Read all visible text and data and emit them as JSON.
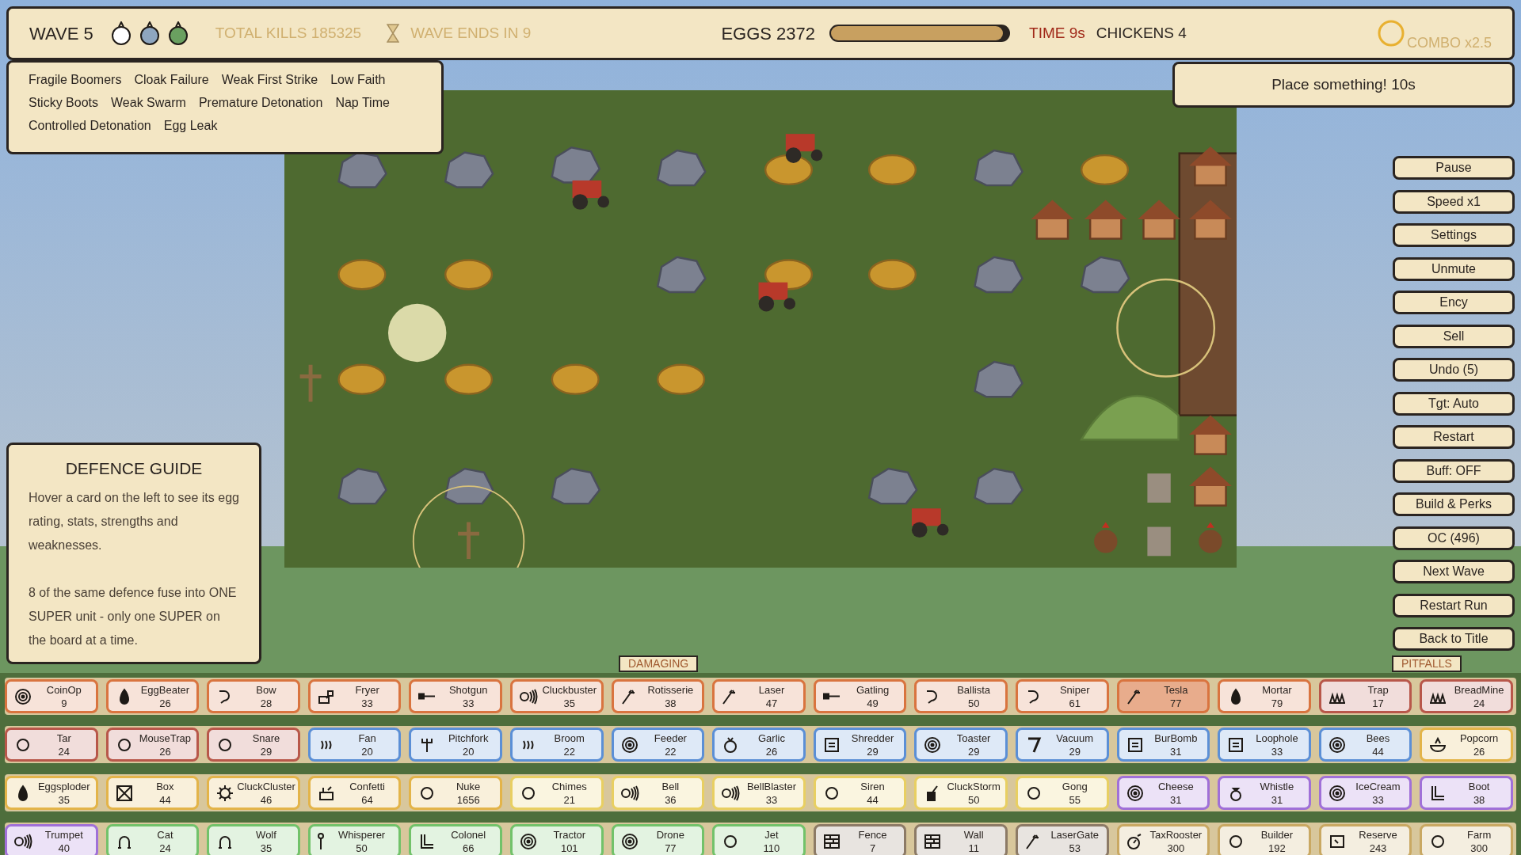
{
  "hud": {
    "wave": "WAVE 5",
    "enemy_types": [
      {
        "color": "#ffffff"
      },
      {
        "color": "#8ea6c0"
      },
      {
        "color": "#6aa060"
      }
    ],
    "total_kills": "TOTAL KILLS 185325",
    "wave_timer": "WAVE ENDS IN 9",
    "eggs": "EGGS 2372",
    "egg_bar": {
      "level": 0.97
    },
    "time": "TIME 9s",
    "chickens": "CHICKENS 4",
    "combo": "COMBO x2.5"
  },
  "modifiers": [
    "Fragile Boomers",
    "Cloak Failure",
    "Weak First Strike",
    "Low Faith",
    "Sticky Boots",
    "Weak Swarm",
    "Premature Detonation",
    "Nap Time",
    "Controlled Detonation",
    "Egg Leak"
  ],
  "notice": "Place something! 10s",
  "guide": {
    "title": "DEFENCE GUIDE",
    "paragraphs": [
      "Hover a card on the left to see its egg rating, stats, strengths and weaknesses.",
      "8 of the same defence fuse into ONE SUPER unit - only one SUPER on the board at a time."
    ]
  },
  "menu_buttons": [
    "Pause",
    "Speed x1",
    "Settings",
    "Unmute",
    "Ency",
    "Sell",
    "Undo (5)",
    "Tgt: Auto",
    "Restart",
    "Buff: OFF",
    "Build & Perks",
    "OC (496)",
    "Next Wave",
    "Restart Run",
    "Back to Title"
  ],
  "category_tags": [
    "DAMAGING",
    "PITFALLS"
  ],
  "card_rows": [
    [
      {
        "name": "CoinOp",
        "cost": "9",
        "kind": "target",
        "color": "#d9743f",
        "selected": false
      },
      {
        "name": "EggBeater",
        "cost": "26",
        "kind": "bomb",
        "color": "#d9743f",
        "selected": false
      },
      {
        "name": "Bow",
        "cost": "28",
        "kind": "hook",
        "color": "#d9743f",
        "selected": false
      },
      {
        "name": "Fryer",
        "cost": "33",
        "kind": "fryer",
        "color": "#d9743f",
        "selected": false
      },
      {
        "name": "Shotgun",
        "cost": "33",
        "kind": "gun",
        "color": "#d9743f",
        "selected": false
      },
      {
        "name": "Cluckbuster",
        "cost": "35",
        "kind": "sound",
        "color": "#d9743f",
        "selected": false
      },
      {
        "name": "Rotisserie",
        "cost": "38",
        "kind": "wand",
        "color": "#d9743f",
        "selected": false
      },
      {
        "name": "Laser",
        "cost": "47",
        "kind": "wand",
        "color": "#d9743f",
        "selected": false
      },
      {
        "name": "Gatling",
        "cost": "49",
        "kind": "gun",
        "color": "#d9743f",
        "selected": false
      },
      {
        "name": "Ballista",
        "cost": "50",
        "kind": "hook",
        "color": "#d9743f",
        "selected": false
      },
      {
        "name": "Sniper",
        "cost": "61",
        "kind": "hook",
        "color": "#d9743f",
        "selected": false
      },
      {
        "name": "Tesla",
        "cost": "77",
        "kind": "wand",
        "color": "#d9743f",
        "selected": true
      },
      {
        "name": "Mortar",
        "cost": "79",
        "kind": "bomb",
        "color": "#d9743f",
        "selected": false
      },
      {
        "name": "Trap",
        "cost": "17",
        "kind": "spikes",
        "color": "#b8574a",
        "selected": false
      },
      {
        "name": "BreadMine",
        "cost": "24",
        "kind": "spikes",
        "color": "#b8574a",
        "selected": false
      }
    ],
    [
      {
        "name": "Tar",
        "cost": "24",
        "kind": "circle",
        "color": "#b8574a",
        "selected": false
      },
      {
        "name": "MouseTrap",
        "cost": "26",
        "kind": "circle",
        "color": "#b8574a",
        "selected": false
      },
      {
        "name": "Snare",
        "cost": "29",
        "kind": "circle",
        "color": "#b8574a",
        "selected": false
      },
      {
        "name": "Fan",
        "cost": "20",
        "kind": "waves",
        "color": "#5b8fd6",
        "selected": false
      },
      {
        "name": "Pitchfork",
        "cost": "20",
        "kind": "fork",
        "color": "#5b8fd6",
        "selected": false
      },
      {
        "name": "Broom",
        "cost": "22",
        "kind": "waves",
        "color": "#5b8fd6",
        "selected": false
      },
      {
        "name": "Feeder",
        "cost": "22",
        "kind": "target",
        "color": "#5b8fd6",
        "selected": false
      },
      {
        "name": "Garlic",
        "cost": "26",
        "kind": "bulb",
        "color": "#5b8fd6",
        "selected": false
      },
      {
        "name": "Shredder",
        "cost": "29",
        "kind": "lines",
        "color": "#5b8fd6",
        "selected": false
      },
      {
        "name": "Toaster",
        "cost": "29",
        "kind": "target",
        "color": "#5b8fd6",
        "selected": false
      },
      {
        "name": "Vacuum",
        "cost": "29",
        "kind": "angle",
        "color": "#5b8fd6",
        "selected": false
      },
      {
        "name": "BurBomb",
        "cost": "31",
        "kind": "lines",
        "color": "#5b8fd6",
        "selected": false
      },
      {
        "name": "Loophole",
        "cost": "33",
        "kind": "lines",
        "color": "#5b8fd6",
        "selected": false
      },
      {
        "name": "Bees",
        "cost": "44",
        "kind": "target",
        "color": "#5b8fd6",
        "selected": false
      },
      {
        "name": "Popcorn",
        "cost": "26",
        "kind": "bowl",
        "color": "#e3b449",
        "selected": false
      }
    ],
    [
      {
        "name": "Eggsploder",
        "cost": "35",
        "kind": "bomb",
        "color": "#e3b449",
        "selected": false
      },
      {
        "name": "Box",
        "cost": "44",
        "kind": "crossbox",
        "color": "#e3b449",
        "selected": false
      },
      {
        "name": "CluckCluster",
        "cost": "46",
        "kind": "gear",
        "color": "#e3b449",
        "selected": false
      },
      {
        "name": "Confetti",
        "cost": "64",
        "kind": "popper",
        "color": "#e3b449",
        "selected": false
      },
      {
        "name": "Nuke",
        "cost": "1656",
        "kind": "circle",
        "color": "#e3b449",
        "selected": false
      },
      {
        "name": "Chimes",
        "cost": "21",
        "kind": "circle",
        "color": "#e8cf62",
        "selected": false
      },
      {
        "name": "Bell",
        "cost": "36",
        "kind": "sound",
        "color": "#e8cf62",
        "selected": false
      },
      {
        "name": "BellBlaster",
        "cost": "33",
        "kind": "sound",
        "color": "#e8cf62",
        "selected": false
      },
      {
        "name": "Siren",
        "cost": "44",
        "kind": "circle",
        "color": "#e8cf62",
        "selected": false
      },
      {
        "name": "CluckStorm",
        "cost": "50",
        "kind": "cup",
        "color": "#e8cf62",
        "selected": false
      },
      {
        "name": "Gong",
        "cost": "55",
        "kind": "circle",
        "color": "#e8cf62",
        "selected": false
      },
      {
        "name": "Cheese",
        "cost": "31",
        "kind": "target",
        "color": "#a070d8",
        "selected": false
      },
      {
        "name": "Whistle",
        "cost": "31",
        "kind": "ring",
        "color": "#a070d8",
        "selected": false
      },
      {
        "name": "IceCream",
        "cost": "33",
        "kind": "target",
        "color": "#a070d8",
        "selected": false
      },
      {
        "name": "Boot",
        "cost": "38",
        "kind": "corner",
        "color": "#a070d8",
        "selected": false
      }
    ],
    [
      {
        "name": "Trumpet",
        "cost": "40",
        "kind": "sound",
        "color": "#a070d8",
        "selected": false
      },
      {
        "name": "Cat",
        "cost": "24",
        "kind": "arch",
        "color": "#72c26a",
        "selected": false
      },
      {
        "name": "Wolf",
        "cost": "35",
        "kind": "arch",
        "color": "#72c26a",
        "selected": false
      },
      {
        "name": "Whisperer",
        "cost": "50",
        "kind": "pin",
        "color": "#72c26a",
        "selected": false
      },
      {
        "name": "Colonel",
        "cost": "66",
        "kind": "corner",
        "color": "#72c26a",
        "selected": false
      },
      {
        "name": "Tractor",
        "cost": "101",
        "kind": "target",
        "color": "#72c26a",
        "selected": false
      },
      {
        "name": "Drone",
        "cost": "77",
        "kind": "target",
        "color": "#72c26a",
        "selected": false
      },
      {
        "name": "Jet",
        "cost": "110",
        "kind": "circle",
        "color": "#72c26a",
        "selected": false
      },
      {
        "name": "Fence",
        "cost": "7",
        "kind": "brick",
        "color": "#8c7a66",
        "selected": false
      },
      {
        "name": "Wall",
        "cost": "11",
        "kind": "brick",
        "color": "#8c7a66",
        "selected": false
      },
      {
        "name": "LaserGate",
        "cost": "53",
        "kind": "wand",
        "color": "#8c7a66",
        "selected": false
      },
      {
        "name": "TaxRooster",
        "cost": "300",
        "kind": "stopwatch",
        "color": "#c9a862",
        "selected": false
      },
      {
        "name": "Builder",
        "cost": "192",
        "kind": "circle",
        "color": "#c9a862",
        "selected": false
      },
      {
        "name": "Reserve",
        "cost": "243",
        "kind": "frame",
        "color": "#c9a862",
        "selected": false
      },
      {
        "name": "Farm",
        "cost": "300",
        "kind": "circle",
        "color": "#c9a862",
        "selected": false
      }
    ]
  ]
}
